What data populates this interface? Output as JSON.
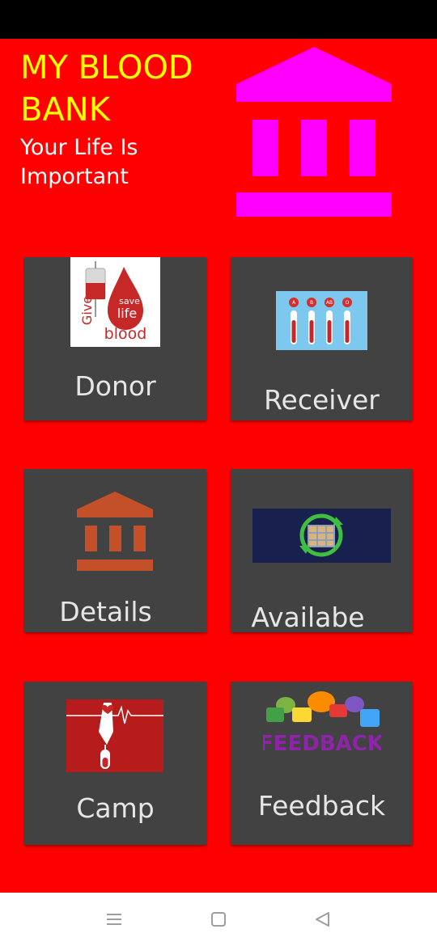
{
  "header": {
    "title": "MY BLOOD BANK",
    "subtitle": "Your Life Is Important"
  },
  "tiles": [
    {
      "label": "Donor",
      "icon": "give-blood-icon",
      "image_text": {
        "save": "save",
        "life": "life",
        "give": "Give",
        "blood": "blood"
      }
    },
    {
      "label": "Receiver",
      "icon": "blood-test-tubes-icon",
      "image_text": {
        "a": "A",
        "b": "B",
        "ab": "AB",
        "o": "O"
      }
    },
    {
      "label": "Details",
      "icon": "bank-building-icon"
    },
    {
      "label": "Availabe",
      "icon": "stock-refresh-icon"
    },
    {
      "label": "Camp",
      "icon": "blood-donation-camp-icon"
    },
    {
      "label": "Feedback",
      "icon": "feedback-bubbles-icon",
      "image_text": "FEEDBACK"
    }
  ],
  "colors": {
    "background": "#ff0000",
    "title": "#ffff00",
    "logo": "#ff00ff",
    "tile": "#424242",
    "tile_text": "#e6e6e6"
  },
  "navbar": [
    "menu-icon",
    "home-icon",
    "back-icon"
  ]
}
